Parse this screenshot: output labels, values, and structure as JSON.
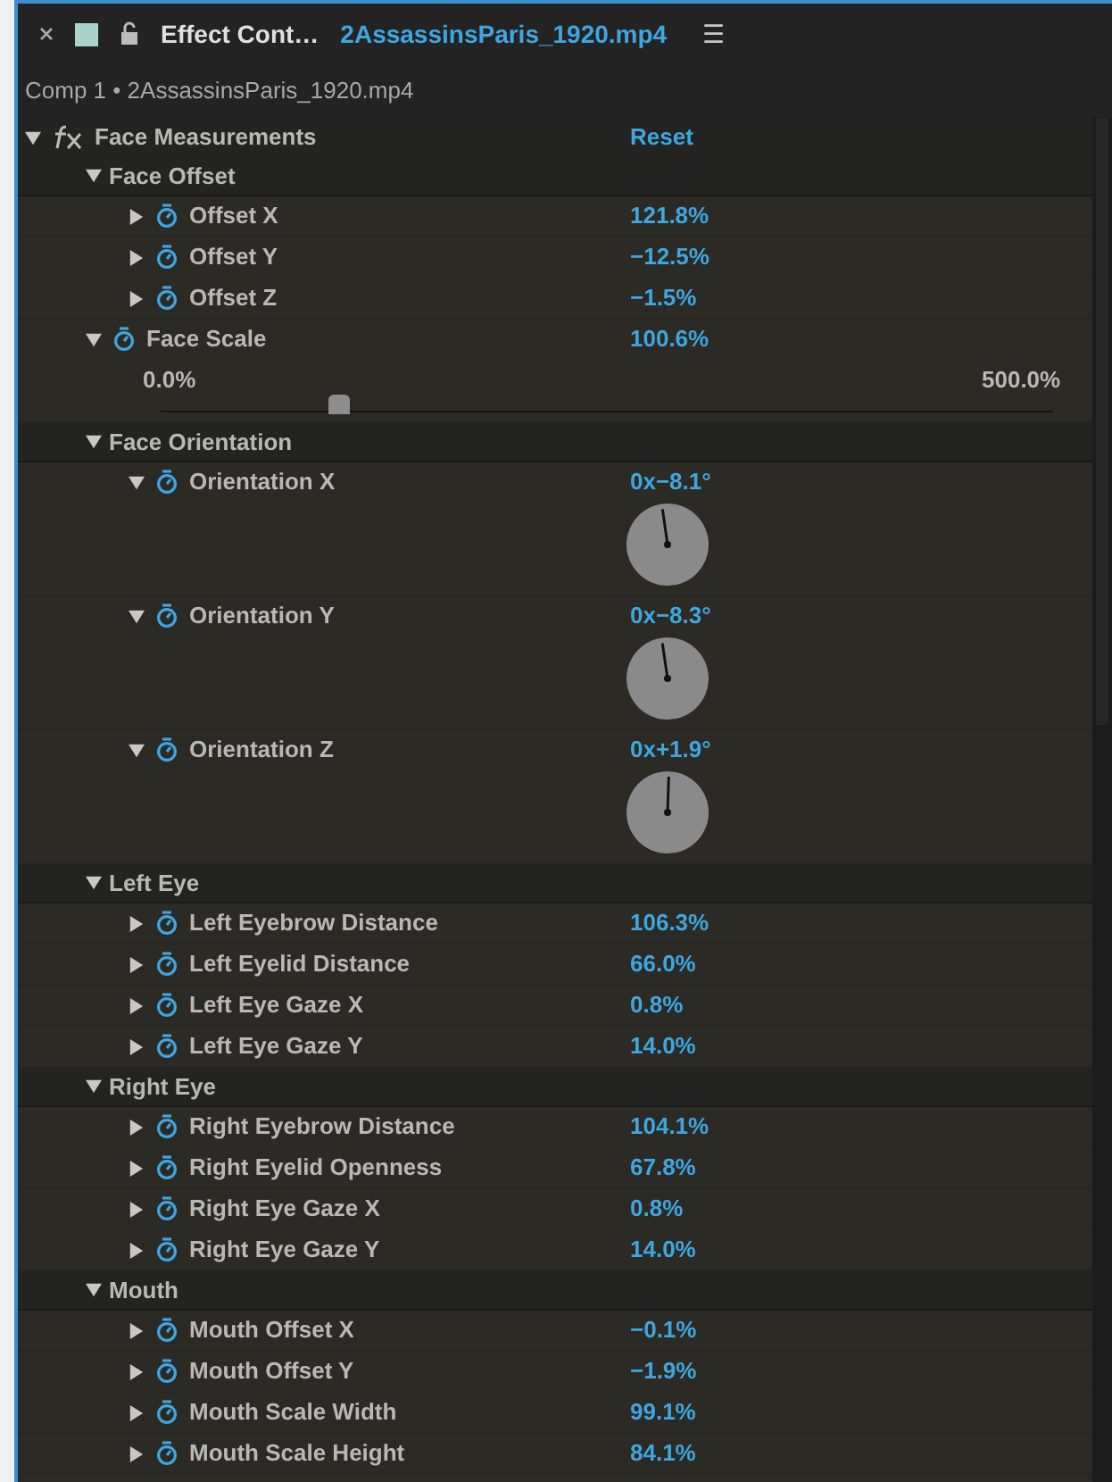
{
  "tab": {
    "title": "Effect Cont…",
    "file": "2AssassinsParis_1920.mp4",
    "menu": "☰"
  },
  "breadcrumb": "Comp 1 • 2AssassinsParis_1920.mp4",
  "effect": {
    "name": "Face Measurements",
    "reset": "Reset",
    "expanded": true,
    "children": [
      {
        "kind": "group",
        "name": "Face Offset",
        "expanded": true,
        "children": [
          {
            "kind": "value",
            "name": "Offset X",
            "value": "121.8%",
            "expanded": false
          },
          {
            "kind": "value",
            "name": "Offset Y",
            "value": "−12.5%",
            "expanded": false
          },
          {
            "kind": "value",
            "name": "Offset Z",
            "value": "−1.5%",
            "expanded": false
          }
        ]
      },
      {
        "kind": "slider",
        "name": "Face Scale",
        "value": "100.6%",
        "expanded": true,
        "min": "0.0%",
        "max": "500.0%",
        "level": 0.2
      },
      {
        "kind": "group",
        "name": "Face Orientation",
        "expanded": true,
        "children": [
          {
            "kind": "angle",
            "name": "Orientation X",
            "value": "0x−8.1°",
            "expanded": true
          },
          {
            "kind": "angle",
            "name": "Orientation Y",
            "value": "0x−8.3°",
            "expanded": true
          },
          {
            "kind": "angle",
            "name": "Orientation Z",
            "value": "0x+1.9°",
            "expanded": true
          }
        ]
      },
      {
        "kind": "group",
        "name": "Left Eye",
        "expanded": true,
        "children": [
          {
            "kind": "value",
            "name": "Left Eyebrow Distance",
            "value": "106.3%",
            "expanded": false
          },
          {
            "kind": "value",
            "name": "Left Eyelid Distance",
            "value": "66.0%",
            "expanded": false
          },
          {
            "kind": "value",
            "name": "Left Eye Gaze X",
            "value": "0.8%",
            "expanded": false
          },
          {
            "kind": "value",
            "name": "Left Eye Gaze Y",
            "value": "14.0%",
            "expanded": false
          }
        ]
      },
      {
        "kind": "group",
        "name": "Right Eye",
        "expanded": true,
        "children": [
          {
            "kind": "value",
            "name": "Right Eyebrow Distance",
            "value": "104.1%",
            "expanded": false
          },
          {
            "kind": "value",
            "name": "Right Eyelid Openness",
            "value": "67.8%",
            "expanded": false
          },
          {
            "kind": "value",
            "name": "Right Eye Gaze X",
            "value": "0.8%",
            "expanded": false
          },
          {
            "kind": "value",
            "name": "Right Eye Gaze Y",
            "value": "14.0%",
            "expanded": false
          }
        ]
      },
      {
        "kind": "group",
        "name": "Mouth",
        "expanded": true,
        "children": [
          {
            "kind": "value",
            "name": "Mouth Offset X",
            "value": "−0.1%",
            "expanded": false
          },
          {
            "kind": "value",
            "name": "Mouth Offset Y",
            "value": "−1.9%",
            "expanded": false
          },
          {
            "kind": "value",
            "name": "Mouth Scale Width",
            "value": "99.1%",
            "expanded": false
          },
          {
            "kind": "value",
            "name": "Mouth Scale Height",
            "value": "84.1%",
            "expanded": false
          }
        ]
      }
    ]
  }
}
